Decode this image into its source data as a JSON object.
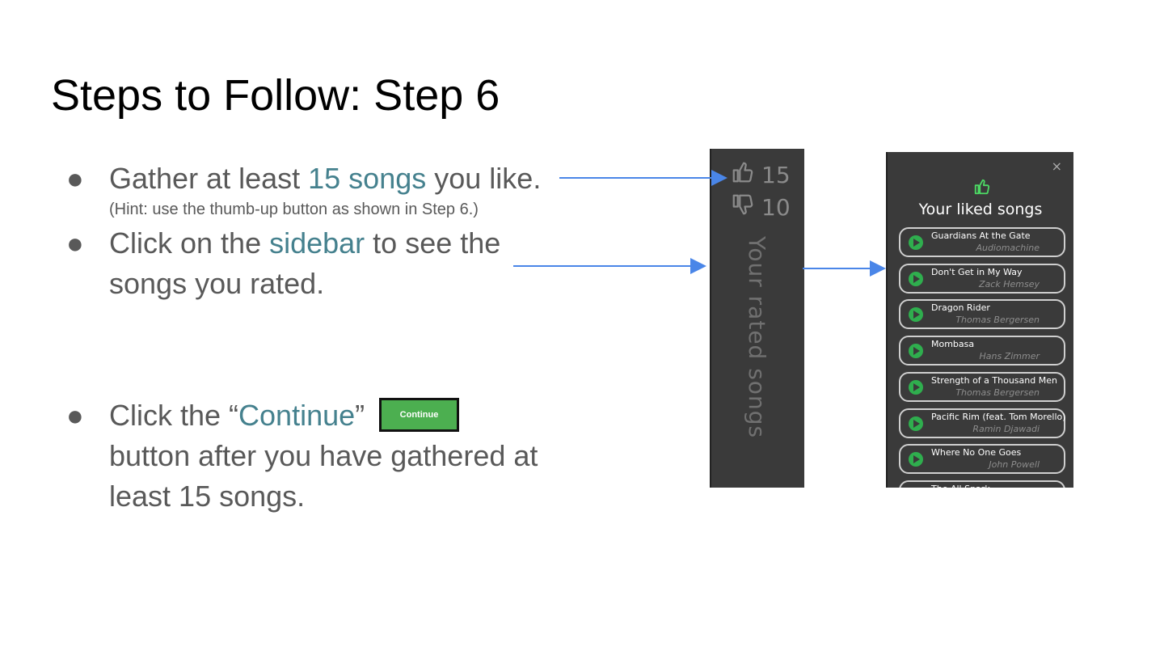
{
  "slide": {
    "title": "Steps to Follow: Step 6"
  },
  "bullets": [
    {
      "parts": [
        "Gather at least ",
        "15 songs",
        " you like."
      ],
      "hint": "(Hint: use the thumb-up button as shown in Step 6.)"
    },
    {
      "line1": [
        "Click on the ",
        "sidebar",
        " to see the"
      ],
      "line2": "songs you rated."
    },
    {
      "line1": [
        "Click the “",
        "Continue",
        "”"
      ],
      "line2": "button after you have gathered at",
      "line3": "least 15 songs."
    }
  ],
  "bullet_glyph": "●",
  "continue_button": {
    "label": "Continue"
  },
  "sidebar": {
    "likes": "15",
    "dislikes": "10",
    "label": "Your rated songs",
    "like_icon": "thumbs-up-icon",
    "dislike_icon": "thumbs-down-icon"
  },
  "liked_panel": {
    "close": "×",
    "title": "Your liked songs",
    "icon": "thumbs-up-icon",
    "icon_color": "#4cd964",
    "songs": [
      {
        "name": "Guardians At the Gate",
        "artist": "Audiomachine"
      },
      {
        "name": "Don't Get in My Way",
        "artist": "Zack Hemsey"
      },
      {
        "name": "Dragon Rider",
        "artist": "Thomas Bergersen"
      },
      {
        "name": "Mombasa",
        "artist": "Hans Zimmer"
      },
      {
        "name": "Strength of a Thousand Men",
        "artist": "Thomas Bergersen"
      },
      {
        "name": "Pacific Rim (feat. Tom Morello)",
        "artist": "Ramin Djawadi"
      },
      {
        "name": "Where No One Goes",
        "artist": "John Powell"
      },
      {
        "name": "The All Spark",
        "artist": ""
      }
    ]
  },
  "colors": {
    "accent_text": "#45818e",
    "arrow": "#4a86e8",
    "continue_green": "#4caf50",
    "panel_bg": "#3a3a3a",
    "play_green": "#2fae4e"
  }
}
